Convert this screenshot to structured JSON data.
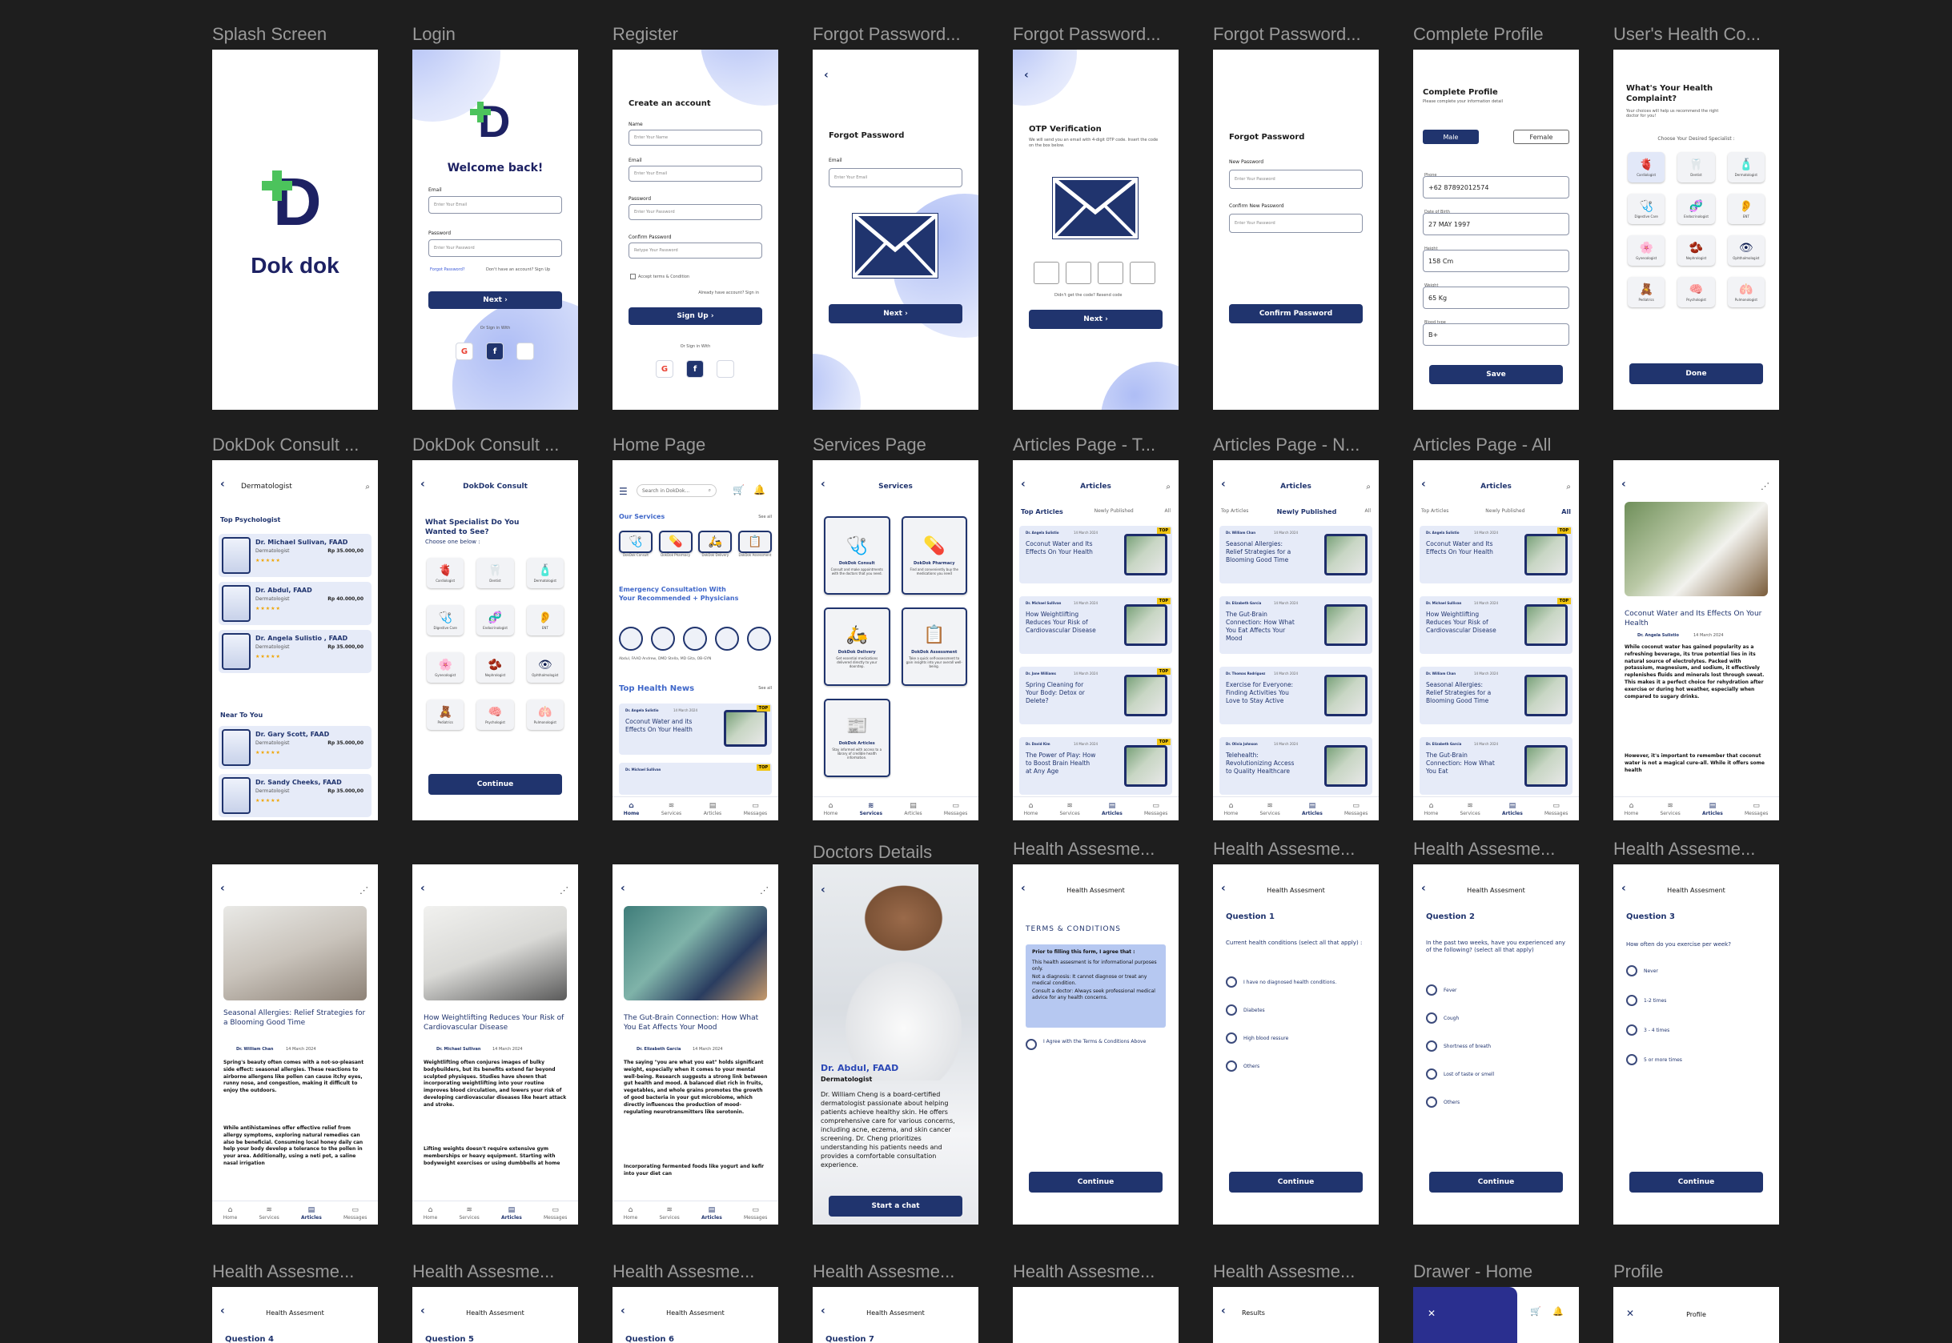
{
  "labels": {
    "splash": "Splash Screen",
    "login": "Login",
    "register": "Register",
    "forgot1": "Forgot Password...",
    "forgot2": "Forgot Password...",
    "forgot3": "Forgot Password...",
    "complete": "Complete Profile",
    "complaint": "User's Health Co...",
    "consult1": "DokDok Consult ...",
    "consult2": "DokDok Consult ...",
    "home": "Home Page",
    "services": "Services Page",
    "art_top": "Articles Page - T...",
    "art_new": "Articles Page - N...",
    "art_all": "Articles Page - All",
    "doctors": "Doctors Details",
    "ha1": "Health Assesme...",
    "ha2": "Health Assesme...",
    "ha3": "Health Assesme...",
    "ha4": "Health Assesme...",
    "r4_1": "Health Assesme...",
    "r4_2": "Health Assesme...",
    "r4_3": "Health Assesme...",
    "r4_4": "Health Assesme...",
    "r4_5": "Health Assesme...",
    "r4_6": "Health Assesme...",
    "drawer": "Drawer - Home",
    "profile": "Profile"
  },
  "splash": {
    "brand": "Dok dok"
  },
  "login": {
    "title": "Welcome back!",
    "email_label": "Email",
    "email_ph": "Enter Your Email",
    "pass_label": "Password",
    "pass_ph": "Enter Your Password",
    "forgot": "Forgot Password?",
    "no_account": "Don't have an account? Sign Up",
    "next": "Next  ›",
    "or": "Or Sign in With"
  },
  "register": {
    "title": "Create an account",
    "name_label": "Name",
    "name_ph": "Enter Your Name",
    "email_label": "Email",
    "email_ph": "Enter Your Email",
    "pass_label": "Password",
    "pass_ph": "Enter Your Password",
    "confirm_label": "Confirm Password",
    "confirm_ph": "Retype Your Password",
    "accept": "Accept terms & Condition",
    "already": "Already have account? Sign in",
    "signup": "Sign Up  ›",
    "or": "Or Sign in With"
  },
  "forgot1": {
    "title": "Forgot Password",
    "email_label": "Email",
    "email_ph": "Enter Your Email",
    "next": "Next  ›"
  },
  "forgot2": {
    "title": "OTP Verification",
    "desc": "We will send you an email with 4-digit OTP code. Insert the code on the box below.",
    "resend": "Didn't get the code? Resend code",
    "next": "Next  ›"
  },
  "forgot3": {
    "title": "Forgot Password",
    "new_label": "New Password",
    "new_ph": "Enter Your Password",
    "confirm_label": "Confirm New Password",
    "confirm_ph": "Enter Your Password",
    "confirm_btn": "Confirm Password"
  },
  "complete": {
    "title": "Complete Profile",
    "sub": "Please complete your information detail",
    "male": "Male",
    "female": "Female",
    "phone_label": "Phone",
    "phone": "+62 87892012574",
    "dob_label": "Date of Birth",
    "dob": "27 MAY 1997",
    "height_label": "Height",
    "height": "158 Cm",
    "weight_label": "Weight",
    "weight": "65 Kg",
    "blood_label": "Blood type",
    "blood": "B+",
    "save": "Save"
  },
  "complaint": {
    "title": "What's Your Health Complaint?",
    "sub": "Your choices will help us recommend the right doctor for you!",
    "choose": "Choose Your Desired Specialist :",
    "done": "Done"
  },
  "specialists": [
    {
      "n": "Cardiologist",
      "i": "🫀"
    },
    {
      "n": "Dentist",
      "i": "🦷"
    },
    {
      "n": "Dermatologist",
      "i": "🧴"
    },
    {
      "n": "Digestive Care",
      "i": "🩺"
    },
    {
      "n": "Endocrinologist",
      "i": "🧬"
    },
    {
      "n": "ENT",
      "i": "👂"
    },
    {
      "n": "Gynecologist",
      "i": "🌸"
    },
    {
      "n": "Nephrologist",
      "i": "🫘"
    },
    {
      "n": "Ophthalmologist",
      "i": "👁"
    },
    {
      "n": "Pediatrics",
      "i": "🧸"
    },
    {
      "n": "Psychologist",
      "i": "🧠"
    },
    {
      "n": "Pulmonologist",
      "i": "🫁"
    }
  ],
  "consult1": {
    "title": "Dermatologist",
    "top": "Top Psychologist",
    "near": "Near To You"
  },
  "doctors_list": [
    {
      "name": "Dr. Michael Sulivan, FAAD",
      "spec": "Dermatologist",
      "price": "Rp 35.000,00",
      "stars": "★★★★★"
    },
    {
      "name": "Dr. Abdul, FAAD",
      "spec": "Dermatologist",
      "price": "Rp 40.000,00",
      "stars": "★★★★★"
    },
    {
      "name": "Dr. Angela Sulistio , FAAD",
      "spec": "Dermatologist",
      "price": "Rp 35.000,00",
      "stars": "★★★★★"
    },
    {
      "name": "Dr. Gary Scott, FAAD",
      "spec": "Dermatologist",
      "price": "Rp 35.000,00",
      "stars": "★★★★★"
    },
    {
      "name": "Dr. Sandy Cheeks, FAAD",
      "spec": "Dermatologist",
      "price": "Rp 35.000,00",
      "stars": "★★★★★"
    }
  ],
  "consult2": {
    "title": "DokDok Consult",
    "q": "What Specialist Do You Wanted to See?",
    "sub": "Choose one below :",
    "continue": "Continue"
  },
  "home": {
    "search": "Search in DokDok...",
    "our_services": "Our Services",
    "see_all": "See all",
    "s1": "DokDok Consult",
    "s2": "DokDok Pharmacy",
    "s3": "DokDok Delivery",
    "s4": "DokDok Assessment",
    "emergency": "Emergency Consultation With Your Recommended + Physicians",
    "docs": "Abdul, FAAD   Andrew, DMD   Stella, MD   Gita, OB-GYN",
    "news": "Top Health News",
    "n_author": "Dr. Angela Sulistio",
    "n_date": "14 March 2024",
    "n_title": "Coconut Water and its Effects On Your Health",
    "n_author2": "Dr. Michael Sullivan"
  },
  "services": {
    "title": "Services",
    "s1": "DokDok Consult",
    "d1": "Consult and make appointments with the doctors that you need.",
    "s2": "DokDok Pharmacy",
    "d2": "Find and conveniently buy the medications you need",
    "s3": "DokDok Delivery",
    "d3": "Get essential medications delivered directly to your doorstep.",
    "s4": "DokDok Assessment",
    "d4": "Take a quick self-assessment to gain insights into your overall well-being.",
    "s5": "DokDok Articles",
    "d5": "Stay informed with access to a library of credible health information."
  },
  "articles": {
    "title": "Articles",
    "tab1": "Top Articles",
    "tab2": "Newly Published",
    "tab3": "All",
    "top": "TOP"
  },
  "art_top_list": [
    {
      "a": "Dr. Angela Sulistio",
      "d": "14 March 2024",
      "t": "Coconut Water and Its Effects On Your Health"
    },
    {
      "a": "Dr. Michael Sullivan",
      "d": "14 March 2024",
      "t": "How Weightlifting Reduces Your Risk of Cardiovascular Disease"
    },
    {
      "a": "Dr. Jane Williams",
      "d": "14 March 2024",
      "t": "Spring Cleaning for Your Body: Detox or Delete?"
    },
    {
      "a": "Dr. David Kim",
      "d": "14 March 2024",
      "t": "The Power of Play: How to Boost Brain Health at Any Age"
    }
  ],
  "art_new_list": [
    {
      "a": "Dr. William Chan",
      "d": "14 March 2024",
      "t": "Seasonal Allergies: Relief Strategies for a Blooming Good Time"
    },
    {
      "a": "Dr. Elizabeth Garcia",
      "d": "14 March 2024",
      "t": "The Gut-Brain Connection: How What You Eat Affects Your Mood"
    },
    {
      "a": "Dr. Thomas Rodriguez",
      "d": "14 March 2024",
      "t": "Exercise for Everyone: Finding Activities You Love to Stay Active"
    },
    {
      "a": "Dr. Olivia Johnson",
      "d": "14 March 2024",
      "t": "Telehealth: Revolutionizing Access to Quality Healthcare"
    }
  ],
  "art_all_list": [
    {
      "a": "Dr. Angela Sulistio",
      "d": "14 March 2024",
      "t": "Coconut Water and Its Effects On Your Health"
    },
    {
      "a": "Dr. Michael Sullivan",
      "d": "14 March 2024",
      "t": "How Weightlifting Reduces Your Risk of Cardiovascular Disease"
    },
    {
      "a": "Dr. William Chan",
      "d": "14 March 2024",
      "t": "Seasonal Allergies: Relief Strategies for a Blooming Good Time"
    },
    {
      "a": "Dr. Elizabeth Garcia",
      "d": "14 March 2024",
      "t": "The Gut-Brain Connection: How What You Eat"
    }
  ],
  "art_detail": {
    "title": "Coconut Water and Its Effects On Your Health",
    "author": "Dr. Angela Sulistio",
    "date": "14 March 2024",
    "p1": "While coconut water has gained popularity as a refreshing beverage, its true potential lies in its natural source of electrolytes. Packed with potassium, magnesium, and sodium, it effectively replenishes fluids and minerals lost through sweat. This makes it a perfect choice for rehydration after exercise or during hot weather, especially when compared to sugary drinks.",
    "p2": "However, it's important to remember that coconut water is not a magical cure-all. While it offers some health"
  },
  "allergy": {
    "title": "Seasonal Allergies: Relief Strategies for a Blooming Good Time",
    "author": "Dr. William Chan",
    "date": "14 March 2024",
    "p1": "Spring's beauty often comes with a not-so-pleasant side effect: seasonal allergies.  These reactions to airborne allergens like pollen can cause itchy eyes, runny nose, and congestion, making it difficult to enjoy the outdoors.",
    "p2": "While antihistamines offer effective relief from allergy symptoms, exploring natural remedies can also be beneficial. Consuming local honey daily can help your body develop a tolerance to the pollen in your area. Additionally, using a neti pot, a saline nasal irrigation"
  },
  "weight": {
    "title": "How Weightlifting Reduces Your Risk of Cardiovascular Disease",
    "author": "Dr. Michael Sullivan",
    "date": "14 March 2024",
    "p1": "Weightlifting often conjures images of bulky bodybuilders, but its benefits extend far beyond sculpted physiques. Studies have shown that incorporating weightlifting into your routine improves blood circulation, and lowers your risk of developing cardiovascular diseases like heart attack and stroke.",
    "p2": "Lifting weights doesn't require extensive gym memberships or heavy equipment. Starting with bodyweight exercises or using dumbbells at home"
  },
  "gut": {
    "title": "The Gut-Brain Connection: How What You Eat Affects Your Mood",
    "author": "Dr. Elizabeth Garcia",
    "date": "14 March 2024",
    "p1": "The saying \"you are what you eat\" holds significant weight, especially when it comes to your mental well-being. Research suggests a strong link between gut health and mood. A balanced diet rich in fruits, vegetables, and whole grains promotes the growth of good bacteria in your gut microbiome, which directly influences the production of mood-regulating neurotransmitters like serotonin.",
    "p2": "Incorporating fermented foods like yogurt and kefir into your diet can"
  },
  "doctor": {
    "name": "Dr. Abdul, FAAD",
    "spec": "Dermatologist",
    "bio": "Dr. William Cheng is a board-certified dermatologist passionate about helping patients achieve healthy skin. He offers comprehensive care for various concerns, including acne, eczema, and skin cancer screening. Dr. Cheng prioritizes understanding his patients needs and provides a comfortable consultation experience.",
    "start": "Start a chat"
  },
  "ha1": {
    "title": "Health Assesment",
    "tc": "TERMS & CONDITIONS",
    "intro": "Prior to filling this form, I agree that :",
    "b1": "This health assesment is for informational purposes only.",
    "b2": "Not a diagnosis: It cannot diagnose or treat any medical condition.",
    "b3": "Consult a doctor: Always seek professional medical advice for any health concerns.",
    "agree": "I Agree with the Terms & Conditions Above",
    "continue": "Continue"
  },
  "ha2": {
    "title": "Health Assesment",
    "q": "Question 1",
    "desc": "Current health conditions (select all that apply) :",
    "opts": [
      "I have no diagnosed health conditions.",
      "Diabetes",
      "High blood ressure",
      "Others"
    ],
    "continue": "Continue"
  },
  "ha3": {
    "title": "Health Assesment",
    "q": "Question 2",
    "desc": "In the past two weeks, have you experienced any of the following? (select all that apply)",
    "opts": [
      "Fever",
      "Cough",
      "Shortness of breath",
      "Lost of taste or smell",
      "Others"
    ],
    "continue": "Continue"
  },
  "ha4": {
    "title": "Health Assesment",
    "q": "Question 3",
    "desc": "How often do you exercise per week?",
    "opts": [
      "Never",
      "1-2 times",
      "3 - 4 times",
      "5 or more times"
    ],
    "continue": "Continue"
  },
  "row4": {
    "ha": "Health Assesment",
    "q4": "Question 4",
    "q5": "Question 5",
    "q6": "Question 6",
    "q7": "Question 7",
    "results": "Results",
    "profile": "Profile"
  },
  "nav": {
    "home": "Home",
    "services": "Services",
    "articles": "Articles",
    "messages": "Messages"
  }
}
